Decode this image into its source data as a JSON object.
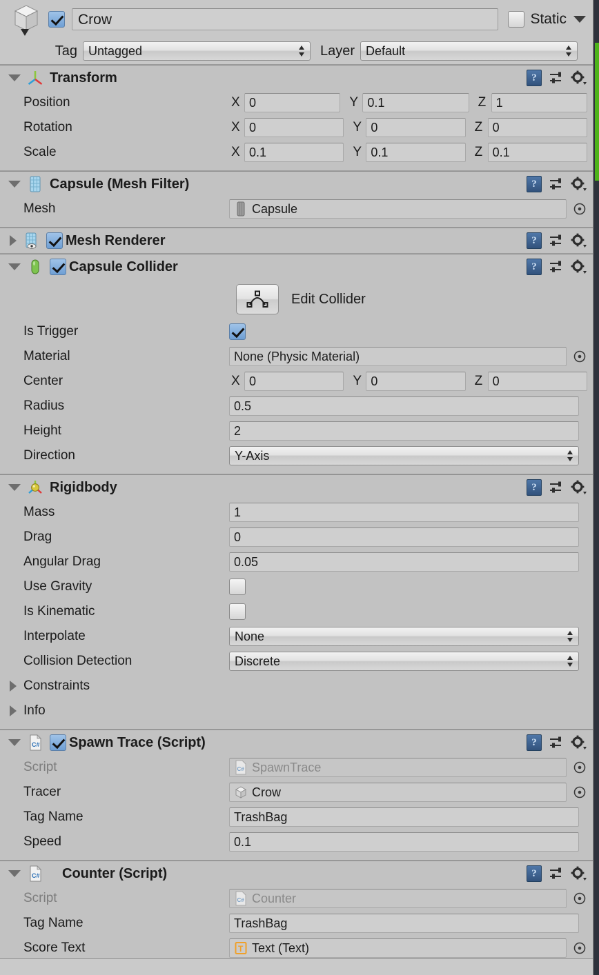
{
  "object_header": {
    "icon": "cube-icon",
    "enabled_checkbox": true,
    "name": "Crow",
    "static_label": "Static",
    "static_checked": false,
    "tag_label": "Tag",
    "tag_value": "Untagged",
    "layer_label": "Layer",
    "layer_value": "Default"
  },
  "components": [
    {
      "id": "transform",
      "title": "Transform",
      "icon": "transform-axis-icon",
      "expanded": true,
      "has_enable_checkbox": false,
      "rows": [
        {
          "type": "vector3",
          "label": "Position",
          "axes": [
            "X",
            "Y",
            "Z"
          ],
          "values": [
            "0",
            "0.1",
            "1"
          ]
        },
        {
          "type": "vector3",
          "label": "Rotation",
          "axes": [
            "X",
            "Y",
            "Z"
          ],
          "values": [
            "0",
            "0",
            "0"
          ]
        },
        {
          "type": "vector3",
          "label": "Scale",
          "axes": [
            "X",
            "Y",
            "Z"
          ],
          "values": [
            "0.1",
            "0.1",
            "0.1"
          ]
        }
      ]
    },
    {
      "id": "mesh-filter",
      "title": "Capsule (Mesh Filter)",
      "icon": "mesh-filter-icon",
      "expanded": true,
      "has_enable_checkbox": false,
      "rows": [
        {
          "type": "object",
          "label": "Mesh",
          "value": "Capsule",
          "thumb": "mesh-thumb-icon"
        }
      ]
    },
    {
      "id": "mesh-renderer",
      "title": "Mesh Renderer",
      "icon": "mesh-renderer-icon",
      "expanded": false,
      "has_enable_checkbox": true,
      "enabled": true,
      "rows": []
    },
    {
      "id": "capsule-collider",
      "title": "Capsule Collider",
      "icon": "capsule-collider-icon",
      "expanded": true,
      "has_enable_checkbox": true,
      "enabled": true,
      "edit_collider_label": "Edit Collider",
      "rows": [
        {
          "type": "toggle",
          "label": "Is Trigger",
          "checked": true
        },
        {
          "type": "object",
          "label": "Material",
          "value": "None (Physic Material)"
        },
        {
          "type": "vector3",
          "label": "Center",
          "axes": [
            "X",
            "Y",
            "Z"
          ],
          "values": [
            "0",
            "0",
            "0"
          ]
        },
        {
          "type": "text",
          "label": "Radius",
          "value": "0.5"
        },
        {
          "type": "text",
          "label": "Height",
          "value": "2"
        },
        {
          "type": "popup",
          "label": "Direction",
          "value": "Y-Axis"
        }
      ]
    },
    {
      "id": "rigidbody",
      "title": "Rigidbody",
      "icon": "rigidbody-icon",
      "expanded": true,
      "has_enable_checkbox": false,
      "rows": [
        {
          "type": "text",
          "label": "Mass",
          "value": "1"
        },
        {
          "type": "text",
          "label": "Drag",
          "value": "0"
        },
        {
          "type": "text",
          "label": "Angular Drag",
          "value": "0.05"
        },
        {
          "type": "toggle",
          "label": "Use Gravity",
          "checked": false
        },
        {
          "type": "toggle",
          "label": "Is Kinematic",
          "checked": false
        },
        {
          "type": "popup",
          "label": "Interpolate",
          "value": "None"
        },
        {
          "type": "popup",
          "label": "Collision Detection",
          "value": "Discrete"
        },
        {
          "type": "foldout",
          "label": "Constraints"
        },
        {
          "type": "foldout",
          "label": "Info"
        }
      ]
    },
    {
      "id": "spawn-trace",
      "title": "Spawn Trace (Script)",
      "icon": "csharp-script-icon",
      "expanded": true,
      "has_enable_checkbox": true,
      "enabled": true,
      "rows": [
        {
          "type": "object",
          "label": "Script",
          "value": "SpawnTrace",
          "readonly": true,
          "thumb": "csharp-script-icon"
        },
        {
          "type": "object",
          "label": "Tracer",
          "value": "Crow",
          "thumb": "prefab-cube-icon"
        },
        {
          "type": "text",
          "label": "Tag Name",
          "value": "TrashBag"
        },
        {
          "type": "text",
          "label": "Speed",
          "value": "0.1"
        }
      ]
    },
    {
      "id": "counter",
      "title": "Counter (Script)",
      "icon": "csharp-script-icon",
      "expanded": true,
      "has_enable_checkbox": false,
      "rows": [
        {
          "type": "object",
          "label": "Script",
          "value": "Counter",
          "readonly": true,
          "thumb": "csharp-script-icon"
        },
        {
          "type": "text",
          "label": "Tag Name",
          "value": "TrashBag"
        },
        {
          "type": "object",
          "label": "Score Text",
          "value": "Text (Text)",
          "thumb": "ui-text-icon"
        }
      ]
    }
  ],
  "tools": {
    "help_icon": "help-book-icon",
    "preset_icon": "preset-sliders-icon",
    "gear_icon": "gear-icon"
  },
  "colors": {
    "panel_bg": "#c2c2c2",
    "header_bg": "#c8c8c8",
    "field_bg": "#cfcfcf",
    "checkbox_accent": "#6f9fd4",
    "scene_green": "#4eb31a",
    "gutter_dark": "#2e323c"
  }
}
